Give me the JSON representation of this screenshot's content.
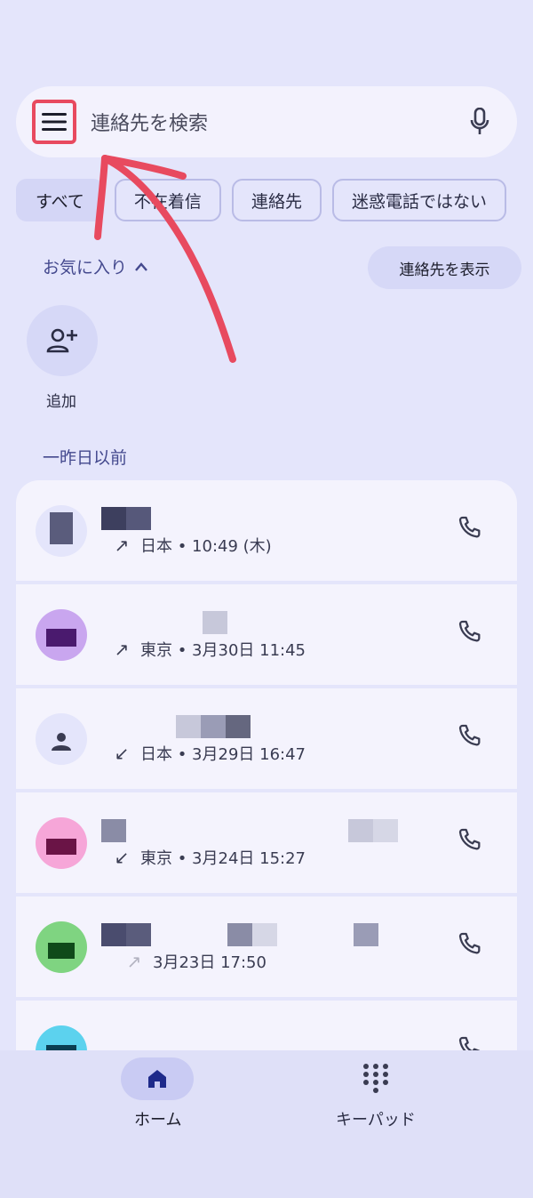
{
  "search": {
    "placeholder": "連絡先を検索"
  },
  "chips": [
    "すべて",
    "不在着信",
    "連絡先",
    "迷惑電話ではない"
  ],
  "favorites": {
    "header": "お気に入り",
    "show_contacts": "連絡先を表示",
    "add_label": "追加"
  },
  "recents": {
    "section_title": "一昨日以前",
    "items": [
      {
        "direction": "outgoing",
        "arrow": "↗",
        "detail": "日本 • 10:49 (木)",
        "avatar_color": "#e4e5fb"
      },
      {
        "direction": "outgoing",
        "arrow": "↗",
        "detail": "東京 • 3月30日 11:45",
        "avatar_color": "#c9a6ef"
      },
      {
        "direction": "incoming",
        "arrow": "↙",
        "detail": "日本 • 3月29日 16:47",
        "avatar_color": "#e4e5fb"
      },
      {
        "direction": "incoming",
        "arrow": "↙",
        "detail": "東京 • 3月24日 15:27",
        "avatar_color": "#f6a6d8"
      },
      {
        "direction": "outgoing",
        "arrow": "↗",
        "detail": "3月23日 17:50",
        "avatar_color": "#7fd481"
      },
      {
        "direction": "outgoing",
        "arrow": "",
        "detail": "",
        "avatar_color": "#5cd2ee"
      }
    ]
  },
  "nav": {
    "home_label": "ホーム",
    "keypad_label": "キーパッド"
  },
  "colors": {
    "accent": "#44498e",
    "annotation": "#e84a5f",
    "background": "#e4e5fb"
  }
}
